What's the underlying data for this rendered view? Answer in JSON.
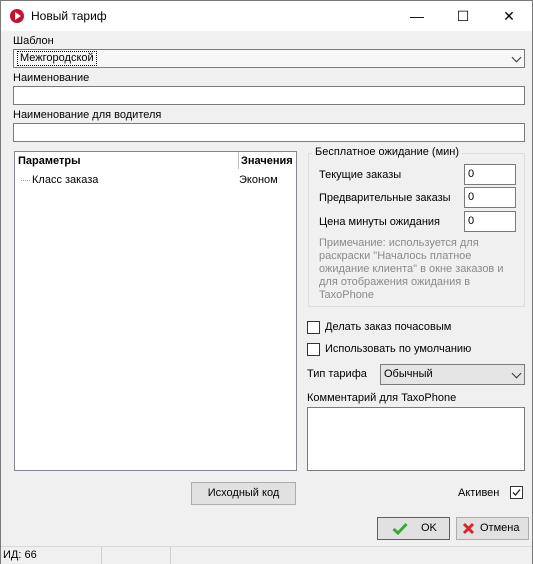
{
  "window": {
    "title": "Новый тариф",
    "minimize": "—",
    "maximize": "☐",
    "close": "✕"
  },
  "template": {
    "label": "Шаблон",
    "value": "Межгородской"
  },
  "name": {
    "label": "Наименование",
    "value": ""
  },
  "driver_name": {
    "label": "Наименование для водителя",
    "value": ""
  },
  "params_tree": {
    "col_params": "Параметры",
    "col_values": "Значения",
    "rows": [
      {
        "param": "Класс заказа",
        "value": "Эконом"
      }
    ]
  },
  "free_wait": {
    "title": "Бесплатное ожидание (мин)",
    "current_label": "Текущие заказы",
    "current_value": "0",
    "preorder_label": "Предварительные заказы",
    "preorder_value": "0",
    "price_label": "Цена минуты ожидания",
    "price_value": "0",
    "note": "Примечание: используется для раскраски \"Началось платное ожидание клиента\" в окне заказов и для отображения ожидания в TaxoPhone"
  },
  "hourly": {
    "label": "Делать заказ почасовым",
    "checked": false
  },
  "default": {
    "label": "Использовать по умолчанию",
    "checked": false
  },
  "tariff_type": {
    "label": "Тип тарифа",
    "value": "Обычный"
  },
  "comment": {
    "label": "Комментарий для TaxoPhone",
    "value": ""
  },
  "source_button": "Исходный код",
  "active": {
    "label": "Активен",
    "checked": true
  },
  "ok_button": "OK",
  "cancel_button": "Отмена",
  "status": {
    "id_text": "ИД: 66"
  },
  "colors": {
    "ok_icon": "#3aa83a",
    "cancel_icon": "#d8262c"
  }
}
